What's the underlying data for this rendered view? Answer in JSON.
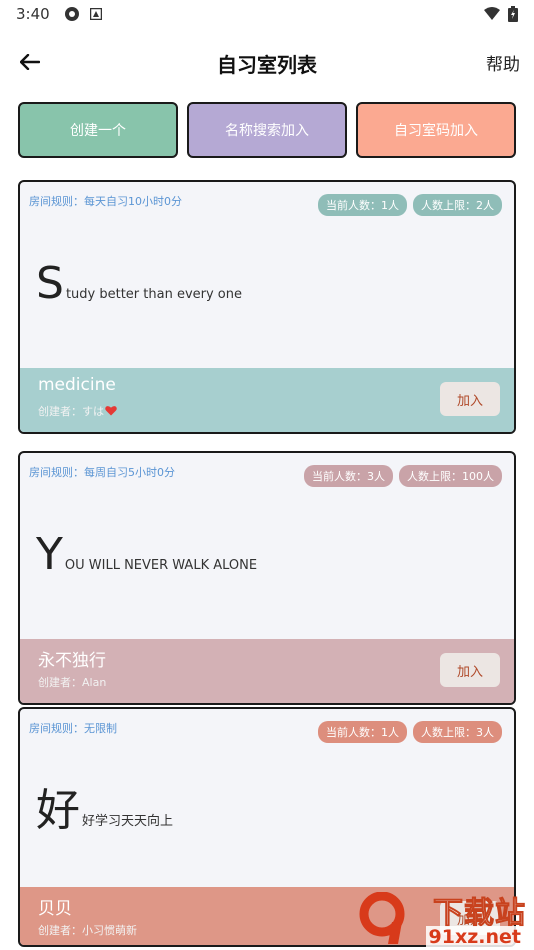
{
  "status_bar": {
    "time": "3:40"
  },
  "header": {
    "title": "自习室列表",
    "help_label": "帮助"
  },
  "actions": {
    "create_label": "创建一个",
    "search_label": "名称搜索加入",
    "code_label": "自习室码加入"
  },
  "colors": {
    "create": "#88c4ab",
    "search": "#b5a9d4",
    "code": "#fba991",
    "rule_text": "#5b95d4"
  },
  "rooms": [
    {
      "rule": "房间规则：每天自习10小时0分",
      "current": "当前人数：1人",
      "limit": "人数上限：2人",
      "slogan_initial": "S",
      "slogan_rest": "tudy better than every one",
      "name": "medicine",
      "creator": "创建者：すは",
      "join_label": "加入",
      "theme_color": "#a7cfcf",
      "badge_color": "#8fbdb8"
    },
    {
      "rule": "房间规则：每周自习5小时0分",
      "current": "当前人数：3人",
      "limit": "人数上限：100人",
      "slogan_initial": "Y",
      "slogan_rest": "OU WILL NEVER WALK ALONE",
      "name": "永不独行",
      "creator": "创建者：Alan",
      "join_label": "加入",
      "theme_color": "#d3b1b5",
      "badge_color": "#c9a3a8"
    },
    {
      "rule": "房间规则：无限制",
      "current": "当前人数：1人",
      "limit": "人数上限：3人",
      "slogan_initial": "好",
      "slogan_rest": "好学习天天向上",
      "name": "贝贝",
      "creator": "创建者：小习惯萌新",
      "join_label": "加入",
      "theme_color": "#de9787",
      "badge_color": "#dd8e7d"
    }
  ],
  "watermark": {
    "line1": "下载站",
    "line2": "91xz.net"
  }
}
